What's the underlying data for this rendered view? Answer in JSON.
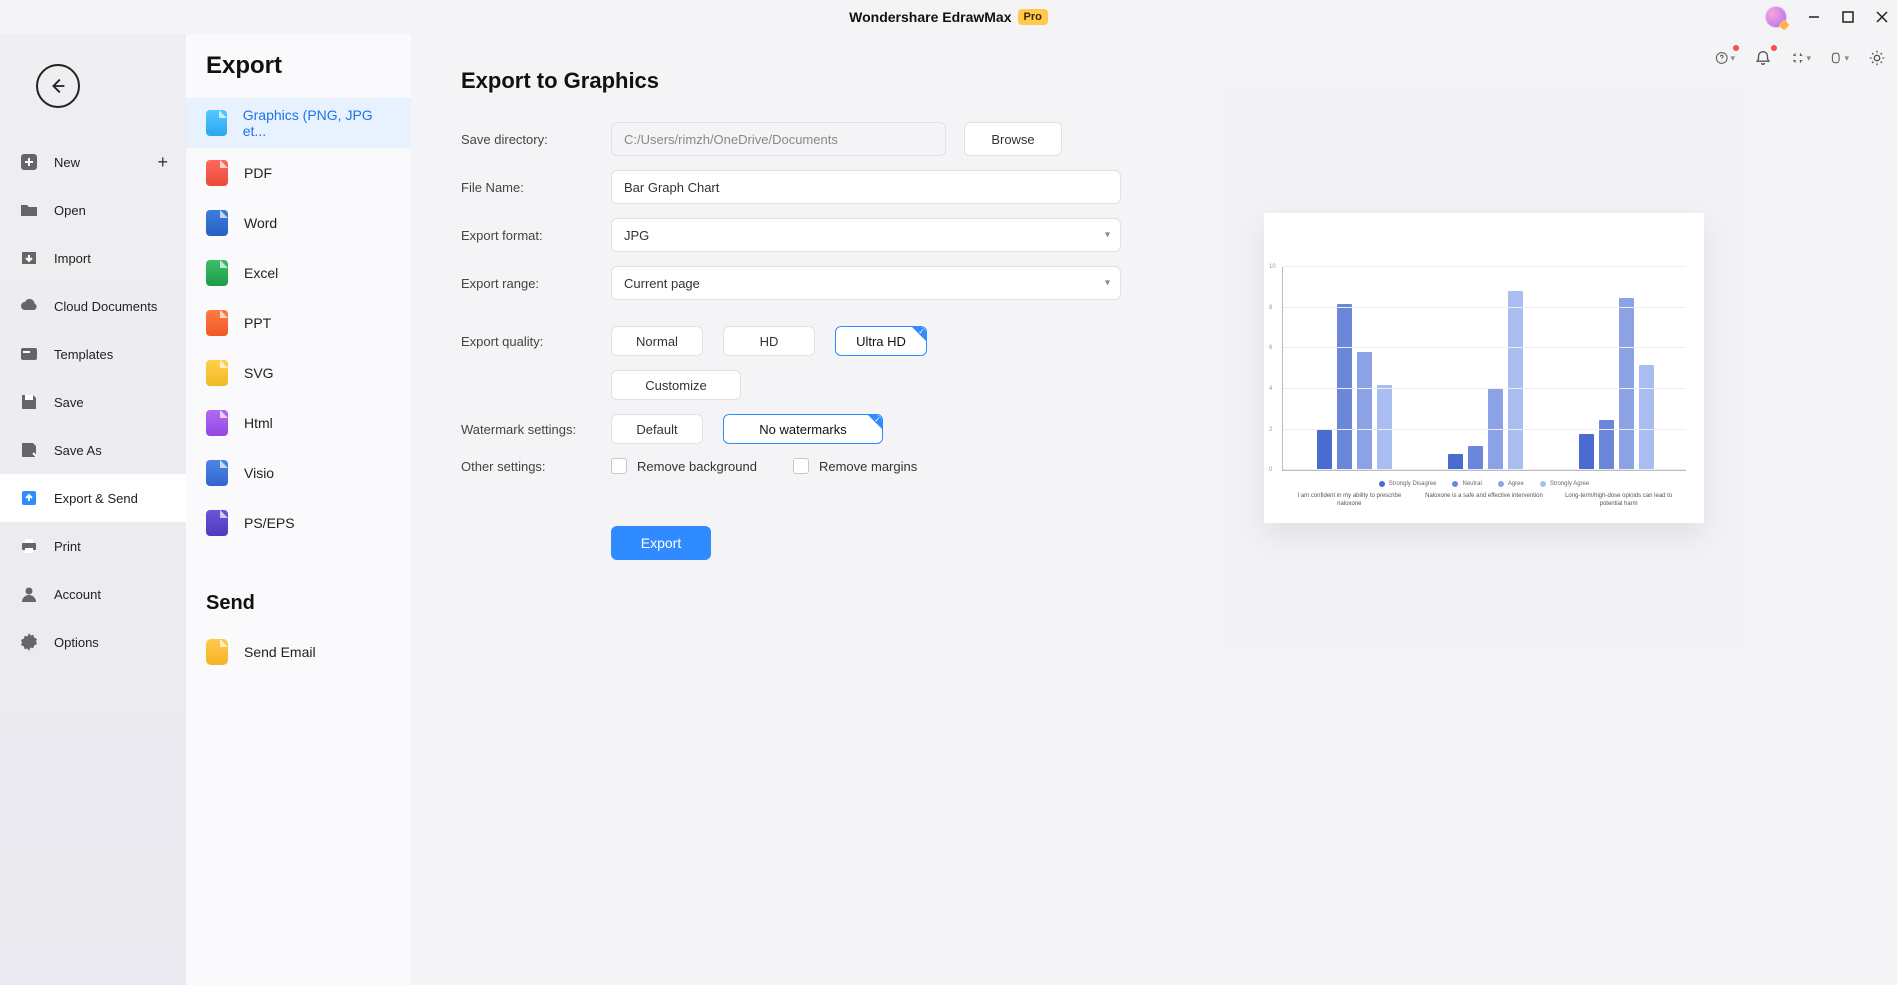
{
  "app": {
    "name": "Wondershare EdrawMax",
    "badge": "Pro"
  },
  "navA": {
    "items": [
      {
        "key": "new",
        "label": "New",
        "plus": true
      },
      {
        "key": "open",
        "label": "Open"
      },
      {
        "key": "import",
        "label": "Import"
      },
      {
        "key": "cloud",
        "label": "Cloud Documents"
      },
      {
        "key": "templates",
        "label": "Templates"
      },
      {
        "key": "save",
        "label": "Save"
      },
      {
        "key": "saveas",
        "label": "Save As"
      },
      {
        "key": "exportsend",
        "label": "Export & Send",
        "active": true
      },
      {
        "key": "print",
        "label": "Print"
      }
    ],
    "footer": [
      {
        "key": "account",
        "label": "Account"
      },
      {
        "key": "options",
        "label": "Options"
      }
    ]
  },
  "colB": {
    "heading_export": "Export",
    "heading_send": "Send",
    "types": [
      {
        "key": "graphics",
        "label": "Graphics (PNG, JPG et...",
        "selected": true
      },
      {
        "key": "pdf",
        "label": "PDF"
      },
      {
        "key": "word",
        "label": "Word"
      },
      {
        "key": "excel",
        "label": "Excel"
      },
      {
        "key": "ppt",
        "label": "PPT"
      },
      {
        "key": "svg",
        "label": "SVG"
      },
      {
        "key": "html",
        "label": "Html"
      },
      {
        "key": "visio",
        "label": "Visio"
      },
      {
        "key": "pseps",
        "label": "PS/EPS"
      }
    ],
    "send": [
      {
        "key": "email",
        "label": "Send Email"
      }
    ]
  },
  "form": {
    "title": "Export to Graphics",
    "labels": {
      "save_dir": "Save directory:",
      "file_name": "File Name:",
      "format": "Export format:",
      "range": "Export range:",
      "quality": "Export quality:",
      "watermark": "Watermark settings:",
      "other": "Other settings:"
    },
    "save_dir_placeholder": "C:/Users/rimzh/OneDrive/Documents",
    "file_name_value": "Bar Graph Chart",
    "format_value": "JPG",
    "range_value": "Current page",
    "browse": "Browse",
    "quality_options": {
      "normal": "Normal",
      "hd": "HD",
      "ultra": "Ultra HD"
    },
    "quality_selected": "ultra",
    "customize": "Customize",
    "watermark_options": {
      "default": "Default",
      "none": "No watermarks"
    },
    "watermark_selected": "none",
    "other_options": {
      "remove_bg": "Remove background",
      "remove_margins": "Remove margins"
    },
    "export_btn": "Export"
  },
  "chart_data": {
    "type": "bar",
    "ylim": [
      0,
      10
    ],
    "yticks": [
      0,
      2,
      4,
      6,
      8,
      10
    ],
    "categories": [
      "I am confident in my ability to prescribe naloxone",
      "Naloxone is a safe and effective intervention",
      "Long-term/high-dose opioids can lead to potential harm"
    ],
    "series": [
      {
        "name": "Strongly Disagree",
        "values": [
          2.0,
          0.8,
          1.8
        ]
      },
      {
        "name": "Neutral",
        "values": [
          8.2,
          1.2,
          2.5
        ]
      },
      {
        "name": "Agree",
        "values": [
          5.8,
          4.0,
          8.5
        ]
      },
      {
        "name": "Strongly Agree",
        "values": [
          4.2,
          8.8,
          5.2
        ]
      }
    ]
  }
}
